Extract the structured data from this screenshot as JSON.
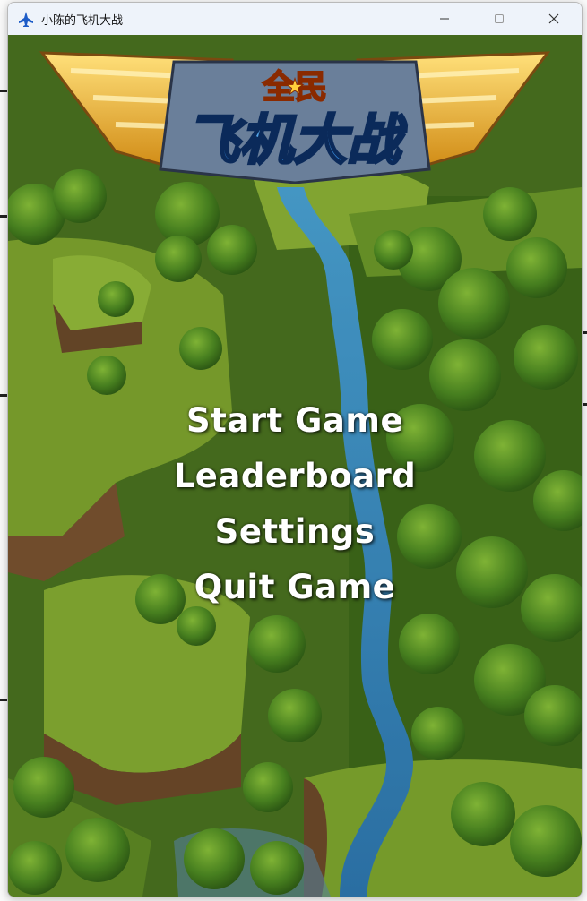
{
  "window": {
    "title": "小陈的飞机大战",
    "controls": {
      "minimize": "—",
      "maximize": "☐",
      "close": "✕"
    }
  },
  "logo": {
    "top_text": "全民",
    "main_text": "飞机大战",
    "star": "★"
  },
  "menu": {
    "items": [
      {
        "label": "Start Game"
      },
      {
        "label": "Leaderboard"
      },
      {
        "label": "Settings"
      },
      {
        "label": "Quit Game"
      }
    ]
  },
  "colors": {
    "grass": "#6a9a2a",
    "cliff": "#8a6a3a",
    "river": "#3a8ec0",
    "logo_gold": "#f2b531",
    "logo_blue": "#2b8ee0"
  }
}
